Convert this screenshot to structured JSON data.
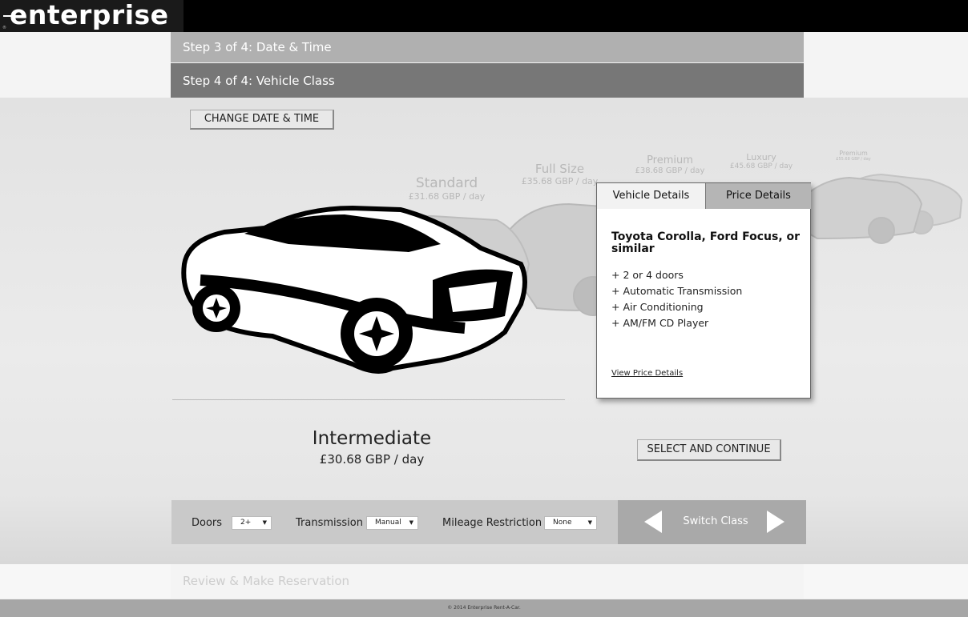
{
  "header": {
    "logo_text": "enterprise",
    "logo_registered": "®"
  },
  "steps": {
    "step3": "Step 3 of 4: Date & Time",
    "step4": "Step 4 of 4: Vehicle Class",
    "review": "Review & Make Reservation"
  },
  "actions": {
    "change_date_time": "CHANGE DATE & TIME",
    "select_continue": "SELECT AND CONTINUE"
  },
  "carousel": {
    "current": {
      "name": "Intermediate",
      "price": "£30.68 GBP / day"
    },
    "others": [
      {
        "name": "Standard",
        "price": "£31.68 GBP / day"
      },
      {
        "name": "Full Size",
        "price": "£35.68 GBP / day"
      },
      {
        "name": "Premium",
        "price": "£38.68 GBP / day"
      },
      {
        "name": "Luxury",
        "price": "£45.68 GBP / day"
      },
      {
        "name": "Premium",
        "price": "£55.68 GBP / day"
      }
    ]
  },
  "popup": {
    "tabs": [
      "Vehicle Details",
      "Price Details"
    ],
    "active_tab": "Vehicle Details",
    "title": "Toyota Corolla, Ford Focus, or similar",
    "features": [
      "+ 2 or 4 doors",
      "+ Automatic Transmission",
      "+ Air Conditioning",
      "+ AM/FM CD Player"
    ],
    "link": "View Price Details"
  },
  "filters": {
    "doors": {
      "label": "Doors",
      "value": "2+"
    },
    "transmission": {
      "label": "Transmission",
      "value": "Manual"
    },
    "mileage": {
      "label": "Mileage Restriction",
      "value": "None"
    },
    "switch_label": "Switch Class"
  },
  "footer": {
    "copyright": "© 2014 Enterprise Rent-A-Car."
  },
  "colors": {
    "topbar": "#000000",
    "active_step": "#777777",
    "inactive_step": "#b0b0b0",
    "filterbar": "#c9c9c9"
  }
}
